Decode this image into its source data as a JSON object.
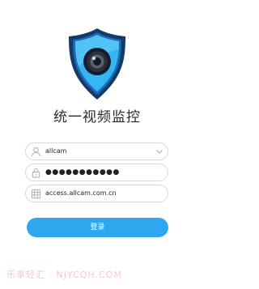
{
  "app": {
    "title": "统一视频监控"
  },
  "login": {
    "username_value": "allcam",
    "password_value": "●●●●●●●●●●●",
    "server_value": "access.allcam.com.cn",
    "submit_label": "登录"
  },
  "watermark": {
    "text": "乐享轻汇 · NJYCQH.COM"
  },
  "colors": {
    "accent": "#2ea7ee",
    "shield_dark": "#153a6a",
    "shield_light": "#35b5f2",
    "field_border": "#d8d8d8",
    "icon": "#b0b0b0"
  },
  "icons": [
    "shield-camera-logo-icon",
    "user-icon",
    "lock-icon",
    "server-icon",
    "chevron-down-icon"
  ]
}
